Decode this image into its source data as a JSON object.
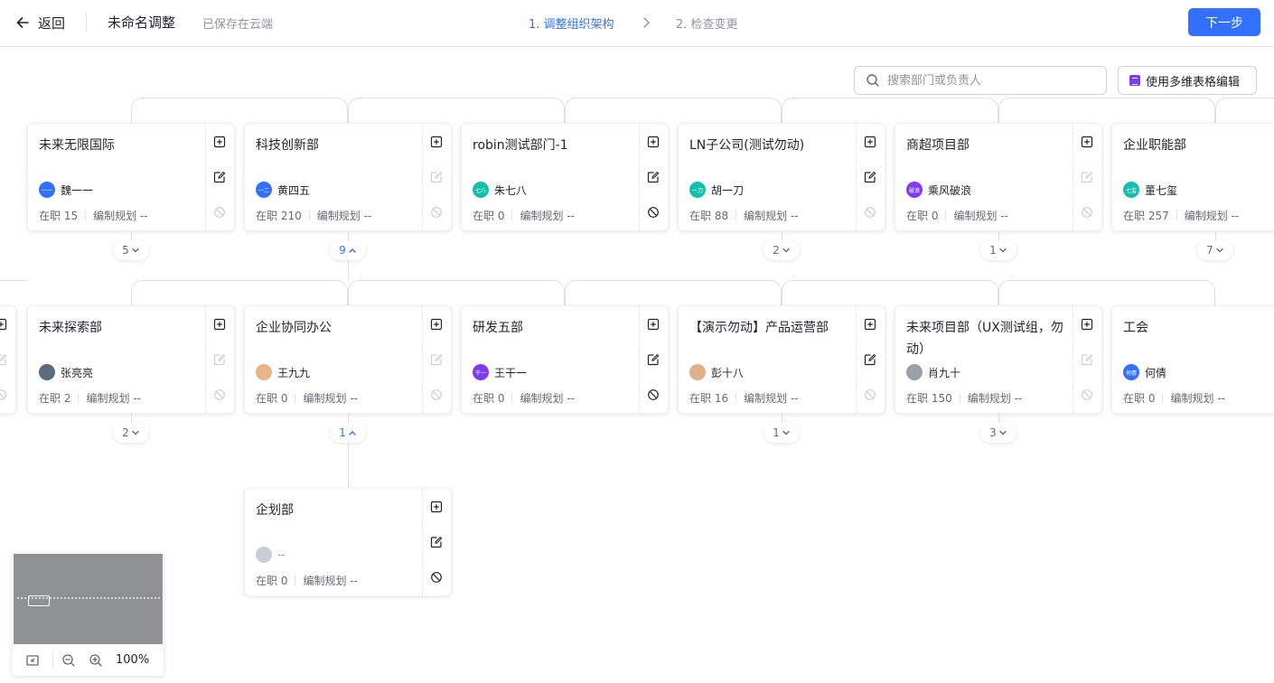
{
  "header": {
    "back_label": "返回",
    "title": "未命名调整",
    "save_status": "已保存在云端",
    "steps": [
      "1. 调整组织架构",
      "2. 检查变更"
    ],
    "next_label": "下一步",
    "active_color": "#3370ff"
  },
  "toolbar": {
    "search_placeholder": "搜索部门或负责人",
    "grid_edit_label": "使用多维表格编辑"
  },
  "stats_labels": {
    "headcount": "在职",
    "quota": "编制规划"
  },
  "level1": [
    {
      "name": "未来无限国际",
      "owner": "魏一一",
      "avatar_text": "一一",
      "avatar_color": "#3370ff",
      "headcount": "15",
      "quota": "--",
      "children_count": "5",
      "expanded": false
    },
    {
      "name": "科技创新部",
      "owner": "黄四五",
      "avatar_text": "一二",
      "avatar_color": "#3370ff",
      "headcount": "210",
      "quota": "--",
      "children_count": "9",
      "expanded": true
    },
    {
      "name": "robin测试部门-1",
      "owner": "朱七八",
      "avatar_text": "七八",
      "avatar_color": "#14c0ad",
      "headcount": "0",
      "quota": "--",
      "children_count": "",
      "expanded": false
    },
    {
      "name": "LN子公司(测试勿动)",
      "owner": "胡一刀",
      "avatar_text": "一刀",
      "avatar_color": "#14c0ad",
      "headcount": "88",
      "quota": "--",
      "children_count": "2",
      "expanded": false
    },
    {
      "name": "商超项目部",
      "owner": "乘风破浪",
      "avatar_text": "破浪",
      "avatar_color": "#7f3bf5",
      "headcount": "0",
      "quota": "--",
      "children_count": "1",
      "expanded": false
    },
    {
      "name": "企业职能部",
      "owner": "董七玺",
      "avatar_text": "七玺",
      "avatar_color": "#14c0ad",
      "headcount": "257",
      "quota": "--",
      "children_count": "7",
      "expanded": false
    }
  ],
  "level2": [
    {
      "name": "未来探索部",
      "owner": "张亮亮",
      "avatar_text": "",
      "avatar_color": "#5b6b7c",
      "headcount": "2",
      "quota": "--",
      "children_count": "2",
      "expanded": false
    },
    {
      "name": "企业协同办公",
      "owner": "王九九",
      "avatar_text": "",
      "avatar_color": "#e8b48a",
      "headcount": "0",
      "quota": "--",
      "children_count": "1",
      "expanded": true
    },
    {
      "name": "研发五部",
      "owner": "王干一",
      "avatar_text": "干一",
      "avatar_color": "#7f3bf5",
      "headcount": "0",
      "quota": "--",
      "children_count": "",
      "expanded": false
    },
    {
      "name": "【演示勿动】产品运营部",
      "owner": "彭十八",
      "avatar_text": "",
      "avatar_color": "#e0b08a",
      "headcount": "16",
      "quota": "--",
      "children_count": "1",
      "expanded": false
    },
    {
      "name": "未来项目部（UX测试组，勿动）",
      "owner": "肖九十",
      "avatar_text": "",
      "avatar_color": "#9aa0a8",
      "headcount": "150",
      "quota": "--",
      "children_count": "3",
      "expanded": false
    },
    {
      "name": "工会",
      "owner": "何倩",
      "avatar_text": "何倩",
      "avatar_color": "#3370ff",
      "headcount": "0",
      "quota": "--",
      "children_count": "",
      "expanded": false
    }
  ],
  "level3": [
    {
      "name": "企划部",
      "owner": "--",
      "avatar_text": "",
      "avatar_color": "#c9cdd4",
      "headcount": "0",
      "quota": "--",
      "children_count": "",
      "expanded": false
    }
  ],
  "minimap": {
    "zoom": "100%"
  }
}
